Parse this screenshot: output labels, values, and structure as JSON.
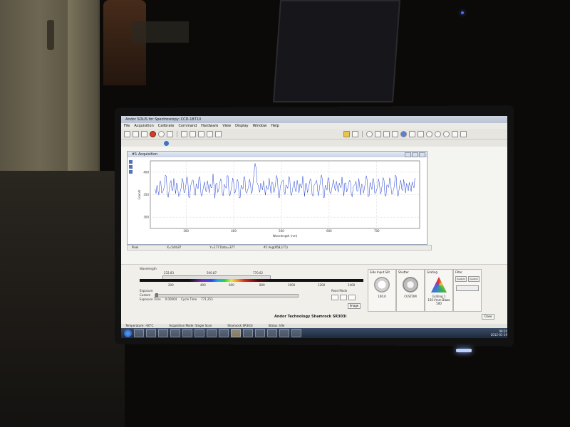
{
  "window": {
    "title": "Andor SOLIS for Spectroscopy: CCD-18710",
    "menu": [
      "File",
      "Acquisition",
      "Calibrate",
      "Command",
      "Hardware",
      "View",
      "Display",
      "Window",
      "Help"
    ]
  },
  "acquisition": {
    "title": "#1 Acquisition",
    "x_label": "Wavelength (nm)",
    "y_label": "Counts",
    "status": [
      "Pixel",
      "X=544.87",
      "Y=177  Data=377",
      "#1 Avg(958,171)"
    ]
  },
  "chart_data": {
    "type": "line",
    "title": "",
    "xlabel": "Wavelength (nm)",
    "ylabel": "Counts",
    "x_ticks": [
      300,
      400,
      500,
      600,
      700
    ],
    "y_ticks": [
      300,
      350,
      400
    ],
    "xlim": [
      225,
      790
    ],
    "ylim": [
      275,
      425
    ],
    "grid": true,
    "series": [
      {
        "color": "#1f3fd0",
        "description": "dense noise around ~365 counts with peak near 405",
        "values": [
          362,
          371,
          349,
          380,
          355,
          368,
          391,
          344,
          375,
          360,
          386,
          352,
          372,
          348,
          366,
          379,
          357,
          390,
          345,
          369,
          383,
          351,
          374,
          363,
          388,
          346,
          370,
          359,
          381,
          354,
          365,
          396,
          342,
          376,
          361,
          385,
          350,
          373,
          364,
          392,
          347,
          368,
          378,
          356,
          384,
          343,
          371,
          362,
          389,
          353,
          367,
          374,
          358,
          401,
          410,
          372,
          355,
          368,
          381,
          349,
          364,
          387,
          352,
          376,
          361,
          393,
          345,
          369,
          380,
          357,
          372,
          364,
          388,
          348,
          373,
          359,
          382,
          354,
          367,
          391,
          346,
          375,
          362,
          385,
          351,
          370,
          378,
          357,
          366,
          394,
          344,
          371,
          360,
          387,
          352,
          374,
          365,
          380,
          355,
          369,
          389,
          347,
          376,
          363,
          382,
          350,
          368,
          373,
          358,
          386,
          349,
          370,
          364,
          392,
          345,
          377,
          361,
          383,
          353,
          367,
          375,
          356,
          388,
          348,
          372,
          366,
          381,
          351,
          369,
          390,
          346,
          374,
          362,
          384,
          354,
          368,
          377,
          357,
          371,
          387
        ]
      }
    ]
  },
  "wavelength": {
    "label": "Wavelength",
    "start": "232.83",
    "center": "500.87",
    "end": "770.02",
    "axis_ticks": [
      "200",
      "400",
      "600",
      "800",
      "1000",
      "1200",
      "1400"
    ]
  },
  "exposure": {
    "label": "Exposure",
    "value_label": "Custom",
    "time_label": "Exposure Time",
    "time_value": "0.00004",
    "cycle_label": "Cycle Time",
    "cycle_value": "771.253"
  },
  "readout": {
    "label": "Read Mode",
    "mode": "Image"
  },
  "modules": {
    "side_input": {
      "title": "Side Input Slit",
      "value": "100.0"
    },
    "shutter": {
      "title": "Shutter",
      "value": "CUSTOM"
    },
    "grating": {
      "title": "Grating",
      "value": "Grating 1",
      "sub": "150 l/mm  Blaze 500"
    },
    "filter": {
      "title": "Filter",
      "options": [
        "Custom",
        "Custom"
      ]
    }
  },
  "company": "Andor Technology Shamrock SR303i",
  "close_label": "Close",
  "statusbar": [
    "Temperature: -60°C",
    "Acquisition Mode: Single Scan",
    "Shamrock SR303i",
    "Status: Idle"
  ],
  "clock": {
    "time": "09:20",
    "date": "2012-01-19"
  }
}
